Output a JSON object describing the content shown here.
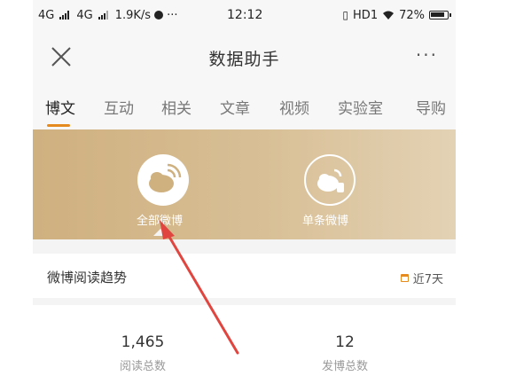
{
  "status_bar": {
    "carrier_1": "4G",
    "carrier_2": "4G",
    "speed": "1.9K/s",
    "dots": "···",
    "time": "12:12",
    "hd": "HD1",
    "battery": "72%"
  },
  "header": {
    "title": "数据助手",
    "more": "···",
    "close_icon": "close-icon"
  },
  "tabs": [
    {
      "label": "博文",
      "active": true
    },
    {
      "label": "互动"
    },
    {
      "label": "相关"
    },
    {
      "label": "文章"
    },
    {
      "label": "视频"
    },
    {
      "label": "实验室"
    },
    {
      "label": "导购"
    }
  ],
  "accent_color": "#e58a1f",
  "banner": {
    "items": [
      {
        "label": "全部微博",
        "icon": "weibo-icon",
        "selected": true
      },
      {
        "label": "单条微博",
        "icon": "weibo-single-icon",
        "selected": false
      }
    ]
  },
  "trend": {
    "title": "微博阅读趋势",
    "range": "近7天"
  },
  "stats": [
    {
      "value": "1,465",
      "label": "阅读总数"
    },
    {
      "value": "12",
      "label": "发博总数"
    }
  ]
}
